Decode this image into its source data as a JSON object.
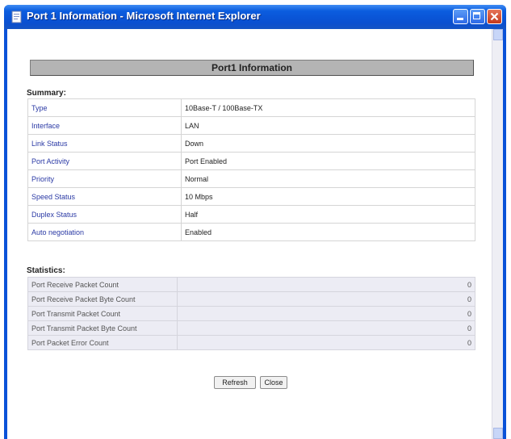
{
  "window": {
    "title": "Port 1 Information - Microsoft Internet Explorer",
    "icon": "ie-page-icon"
  },
  "page": {
    "heading": "Port1 Information",
    "summary_label": "Summary:",
    "statistics_label": "Statistics:",
    "summary": [
      {
        "key": "Type",
        "value": "10Base-T / 100Base-TX"
      },
      {
        "key": "Interface",
        "value": "LAN"
      },
      {
        "key": "Link Status",
        "value": "Down"
      },
      {
        "key": "Port Activity",
        "value": "Port Enabled"
      },
      {
        "key": "Priority",
        "value": "Normal"
      },
      {
        "key": "Speed Status",
        "value": "10 Mbps"
      },
      {
        "key": "Duplex Status",
        "value": "Half"
      },
      {
        "key": "Auto negotiation",
        "value": "Enabled"
      }
    ],
    "statistics": [
      {
        "key": "Port Receive Packet Count",
        "value": "0"
      },
      {
        "key": "Port Receive Packet Byte Count",
        "value": "0"
      },
      {
        "key": "Port Transmit Packet Count",
        "value": "0"
      },
      {
        "key": "Port Transmit Packet Byte Count",
        "value": "0"
      },
      {
        "key": "Port Packet Error Count",
        "value": "0"
      }
    ],
    "buttons": {
      "refresh": "Refresh",
      "close": "Close"
    }
  },
  "colors": {
    "titlebar": "#0a52d8",
    "key_text": "#2b3aa5",
    "heading_bg": "#b4b4b4"
  }
}
